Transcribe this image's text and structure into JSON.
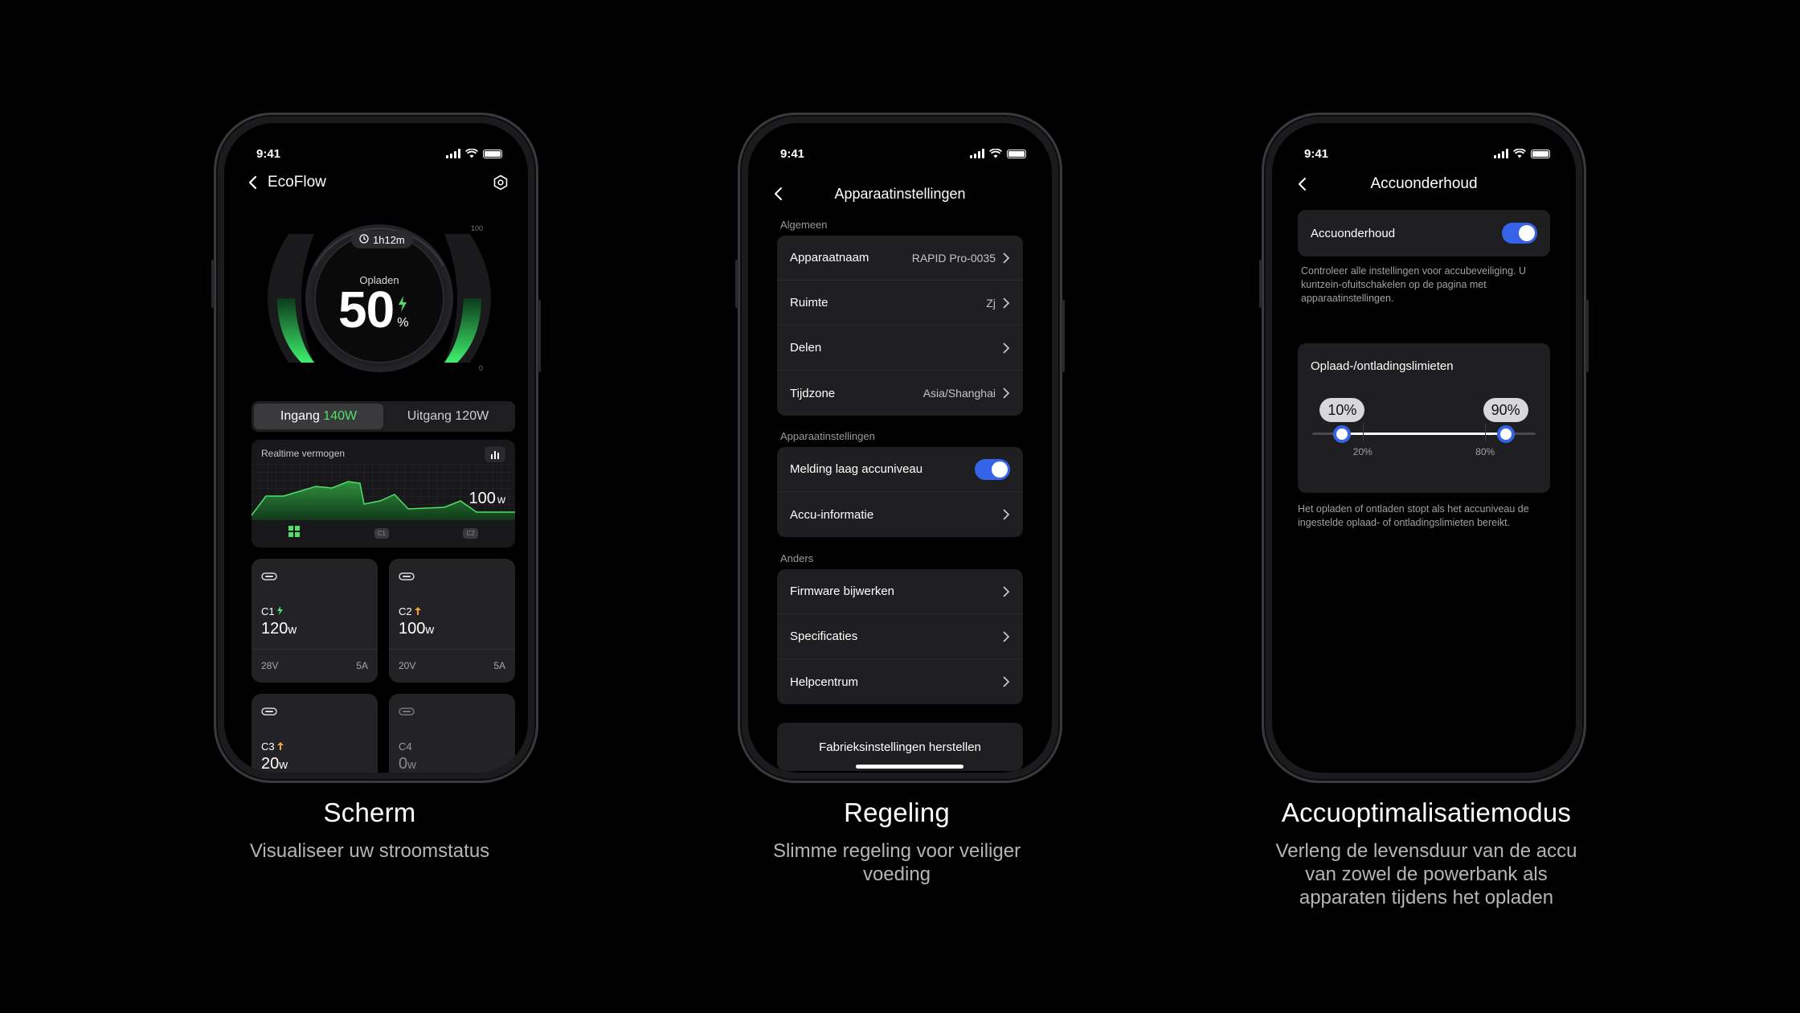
{
  "phones": [
    {
      "status": {
        "time": "9:41"
      },
      "nav": {
        "title": "EcoFlow"
      },
      "gauge": {
        "timer": "1h12m",
        "state": "Opladen",
        "percent": "50",
        "unit": "%",
        "level": 0.5,
        "max_label": "100",
        "min_label": "0"
      },
      "toggle": {
        "input_label": "Ingang",
        "input_value": "140W",
        "output_label": "Uitgang",
        "output_value": "120W"
      },
      "realtime": {
        "title": "Realtime vermogen",
        "value": "100",
        "unit": "w",
        "tabs": [
          "grid-icon",
          "C1",
          "C2"
        ]
      },
      "ports": [
        {
          "name": "C1",
          "dir": "in",
          "value": "120",
          "unit": "w",
          "voltage": "28V",
          "current": "5A"
        },
        {
          "name": "C2",
          "dir": "out",
          "value": "100",
          "unit": "w",
          "voltage": "20V",
          "current": "5A"
        },
        {
          "name": "C3",
          "dir": "out",
          "value": "20",
          "unit": "w"
        },
        {
          "name": "C4",
          "dir": "none",
          "value": "0",
          "unit": "w"
        }
      ]
    },
    {
      "status": {
        "time": "9:41"
      },
      "nav": {
        "title": "Apparaatinstellingen"
      },
      "sections": [
        {
          "label": "Algemeen",
          "rows": [
            {
              "label": "Apparaatnaam",
              "value": "RAPID Pro-0035"
            },
            {
              "label": "Ruimte",
              "value": "Zj"
            },
            {
              "label": "Delen",
              "value": ""
            },
            {
              "label": "Tijdzone",
              "value": "Asia/Shanghai"
            }
          ]
        },
        {
          "label": "Apparaatinstellingen",
          "rows": [
            {
              "label": "Melding laag accuniveau",
              "toggle": true
            },
            {
              "label": "Accu-informatie",
              "value": ""
            }
          ]
        },
        {
          "label": "Anders",
          "rows": [
            {
              "label": "Firmware bijwerken",
              "value": ""
            },
            {
              "label": "Specificaties",
              "value": ""
            },
            {
              "label": "Helpcentrum",
              "value": ""
            }
          ]
        }
      ],
      "reset_label": "Fabrieksinstellingen herstellen"
    },
    {
      "status": {
        "time": "9:41"
      },
      "nav": {
        "title": "Accuonderhoud"
      },
      "maintenance": {
        "label": "Accuonderhoud",
        "enabled": true,
        "note": "Controleer alle instellingen voor accubeveiliging. U kuntzein-ofuitschakelen op de pagina met apparaatinstellingen."
      },
      "limits": {
        "title": "Oplaad-/ontladingslimieten",
        "low_value": "10%",
        "high_value": "90%",
        "low_fraction": 0.1,
        "high_fraction": 0.9,
        "tick_20": "20%",
        "tick_80": "80%",
        "note": "Het opladen of ontladen stopt als het accuniveau de ingestelde oplaad- of ontladingslimieten bereikt."
      }
    }
  ],
  "captions": [
    {
      "title": "Scherm",
      "sub": "Visualiseer uw stroomstatus"
    },
    {
      "title": "Regeling",
      "sub": "Slimme regeling voor veiliger voeding"
    },
    {
      "title": "Accuoptimalisatiemodus",
      "sub": "Verleng de levensduur van de accu van zowel de powerbank als apparaten tijdens het opladen"
    }
  ],
  "colors": {
    "accent_blue": "#3563e9",
    "green": "#4ee06a",
    "orange": "#f2a33a"
  }
}
